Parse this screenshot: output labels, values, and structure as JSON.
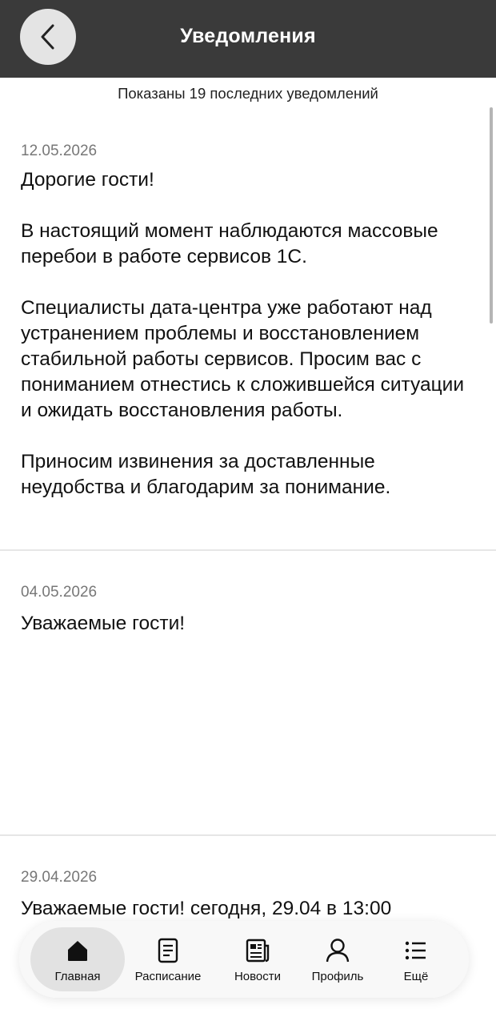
{
  "header": {
    "title": "Уведомления",
    "back_icon": "chevron-left-icon"
  },
  "shown_count": "Показаны 19 последних уведомлений",
  "notifications": [
    {
      "date": "12.05.2026",
      "paragraphs": [
        "Дорогие гости!",
        "В настоящий момент наблюдаются массовые перебои в работе сервисов 1С.",
        "Специалисты дата-центра уже работают над устранением проблемы и восстановлением стабильной работы сервисов. Просим вас с пониманием отнестись к сложившейся ситуации и ожидать восстановления работы.",
        "Приносим извинения за доставленные неудобства и благодарим за понимание."
      ]
    },
    {
      "date": "04.05.2026",
      "paragraphs": [
        "Уважаемые гости!"
      ]
    },
    {
      "date": "29.04.2026",
      "paragraphs": [
        "Уважаемые гости! сегодня, 29.04 в 13:00"
      ]
    }
  ],
  "tabbar": {
    "items": [
      {
        "label": "Главная",
        "icon": "home-icon",
        "active": true
      },
      {
        "label": "Расписание",
        "icon": "schedule-icon",
        "active": false
      },
      {
        "label": "Новости",
        "icon": "news-icon",
        "active": false
      },
      {
        "label": "Профиль",
        "icon": "profile-icon",
        "active": false
      },
      {
        "label": "Ещё",
        "icon": "more-icon",
        "active": false
      }
    ]
  },
  "colors": {
    "header_bg": "#3a3a3a",
    "date": "#777777",
    "text": "#111111"
  }
}
